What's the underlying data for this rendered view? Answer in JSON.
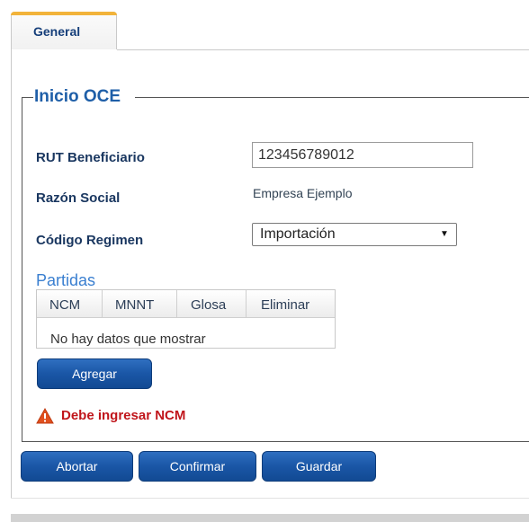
{
  "tabs": [
    {
      "label": "General"
    }
  ],
  "section": {
    "legend": "Inicio OCE"
  },
  "form": {
    "rut_label": "RUT Beneficiario",
    "rut_value": "123456789012",
    "razon_label": "Razón Social",
    "razon_value": "Empresa Ejemplo",
    "codigo_label": "Código Regimen",
    "codigo_selected": "Importación"
  },
  "partidas": {
    "title": "Partidas",
    "columns": [
      "NCM",
      "MNNT",
      "Glosa",
      "Eliminar"
    ],
    "empty_message": "No hay datos que mostrar",
    "add_label": "Agregar"
  },
  "error": {
    "icon": "warning-icon",
    "message": "Debe ingresar NCM",
    "color": "#c0151b"
  },
  "actions": {
    "abort_label": "Abortar",
    "confirm_label": "Confirmar",
    "save_label": "Guardar"
  },
  "colors": {
    "accent": "#1f5fa8",
    "button": "#1a56a6",
    "tab_highlight": "#f2b33a"
  }
}
